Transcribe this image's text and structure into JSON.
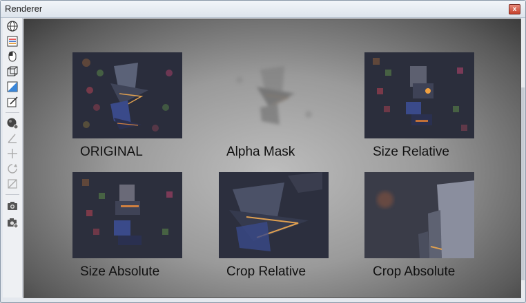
{
  "window": {
    "title": "Renderer",
    "close_glyph": "x"
  },
  "toolbar": {
    "tools": [
      {
        "icon": "globe-icon"
      },
      {
        "icon": "layer-list-icon"
      },
      {
        "icon": "mouse-icon"
      },
      {
        "icon": "cube-icon"
      },
      {
        "icon": "gradient-square-icon"
      },
      {
        "icon": "edit-square-icon"
      },
      {
        "icon": "render-sphere-icon"
      },
      {
        "icon": "angle-icon"
      },
      {
        "icon": "move-cross-icon"
      },
      {
        "icon": "rotate-icon"
      },
      {
        "icon": "scale-icon"
      },
      {
        "icon": "camera-icon"
      },
      {
        "icon": "camera-settings-icon"
      }
    ]
  },
  "panels": [
    {
      "label": "ORIGINAL"
    },
    {
      "label": "Alpha Mask"
    },
    {
      "label": "Size Relative"
    },
    {
      "label": "Size Absolute"
    },
    {
      "label": "Crop Relative"
    },
    {
      "label": "Crop Absolute"
    }
  ],
  "colors": {
    "viewport_center": "#bdbdbd",
    "viewport_edge": "#3c3c3c",
    "accent_orange": "#f0a040"
  }
}
